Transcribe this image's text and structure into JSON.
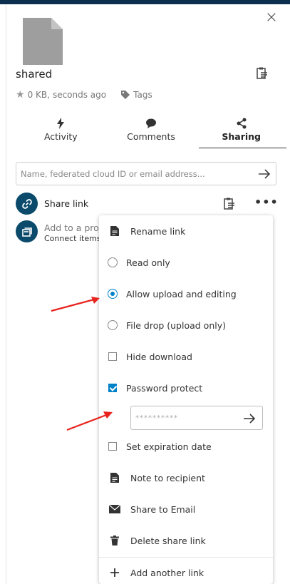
{
  "file": {
    "name": "shared",
    "size": "0 KB,",
    "modified": "seconds ago",
    "tags_label": "Tags"
  },
  "tabs": [
    {
      "label": "Activity",
      "icon": "lightning-icon"
    },
    {
      "label": "Comments",
      "icon": "comment-bubble-icon"
    },
    {
      "label": "Sharing",
      "icon": "share-icon",
      "active": true
    }
  ],
  "share_input": {
    "placeholder": "Name, federated cloud ID or email address..."
  },
  "share_link": {
    "label": "Share link"
  },
  "project": {
    "line1": "Add to a proj",
    "line2": "Connect items"
  },
  "menu": {
    "rename": "Rename link",
    "read_only": "Read only",
    "allow_upload": "Allow upload and editing",
    "file_drop": "File drop (upload only)",
    "hide_download": "Hide download",
    "password_protect": "Password protect",
    "password_value": "**********",
    "set_expiration": "Set expiration date",
    "note": "Note to recipient",
    "share_email": "Share to Email",
    "delete_link": "Delete share link",
    "add_another": "Add another link"
  },
  "state": {
    "permission": "allow_upload",
    "hide_download": false,
    "password_protect": true,
    "set_expiration": false
  },
  "colors": {
    "primary": "#0082c9",
    "dark": "#0b4a6b",
    "annotation": "#e8231e"
  }
}
